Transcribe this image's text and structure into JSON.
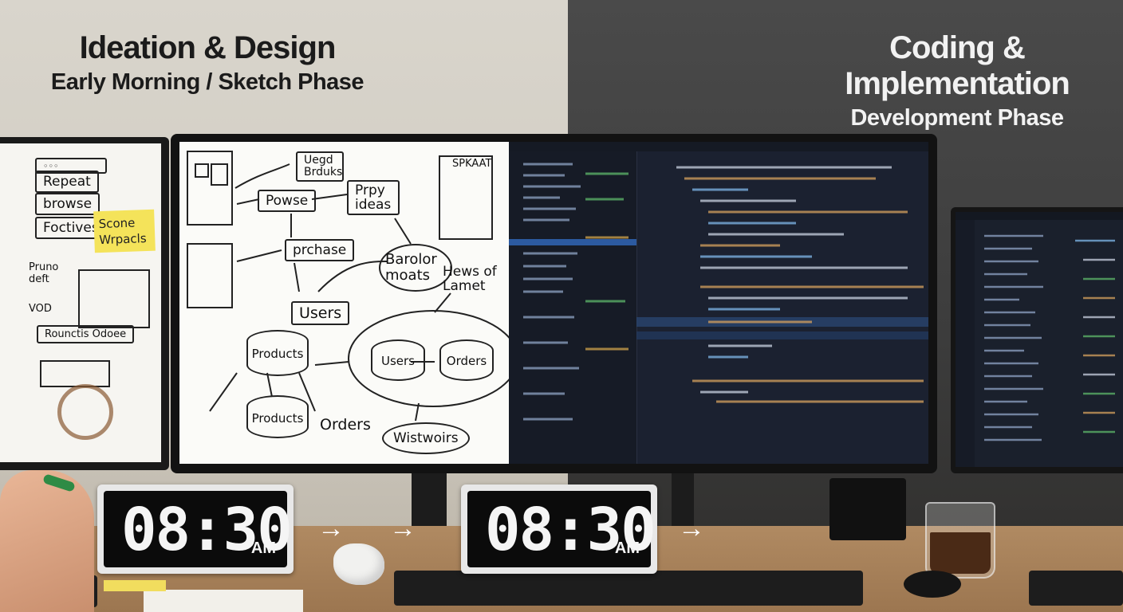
{
  "headings": {
    "left_title": "Ideation & Design",
    "left_subtitle": "Early Morning / Sketch Phase",
    "right_title": "Coding & Implementation",
    "right_subtitle": "Development Phase"
  },
  "left_whiteboard": {
    "boxes": [
      "browse",
      "Repeat",
      "Foctivese",
      "Rounctis Odoee"
    ],
    "labels": [
      "Pruno deft",
      "VOD"
    ],
    "sticky_note": "Scone Wrpacls"
  },
  "main_whiteboard": {
    "boxes": [
      "Uegd Brduks",
      "Powse",
      "Prpy ideas",
      "prchase",
      "Users",
      "SPKAAT"
    ],
    "cylinders": [
      "Products",
      "Products",
      "Users",
      "Orders"
    ],
    "labels": [
      "Barolor moats",
      "Hews of Lamet",
      "Orders",
      "Wistwoirs"
    ]
  },
  "clocks": [
    {
      "time": "08:30",
      "ampm": "AM"
    },
    {
      "time": "08:30",
      "ampm": "AM"
    }
  ],
  "arrows": [
    "→",
    "→",
    "→"
  ],
  "colors": {
    "left_wall": "#d9d5cc",
    "right_wall": "#4a4a4a",
    "desk": "#b08a62",
    "code_bg": "#1b2130",
    "sticky": "#f4e35a"
  }
}
